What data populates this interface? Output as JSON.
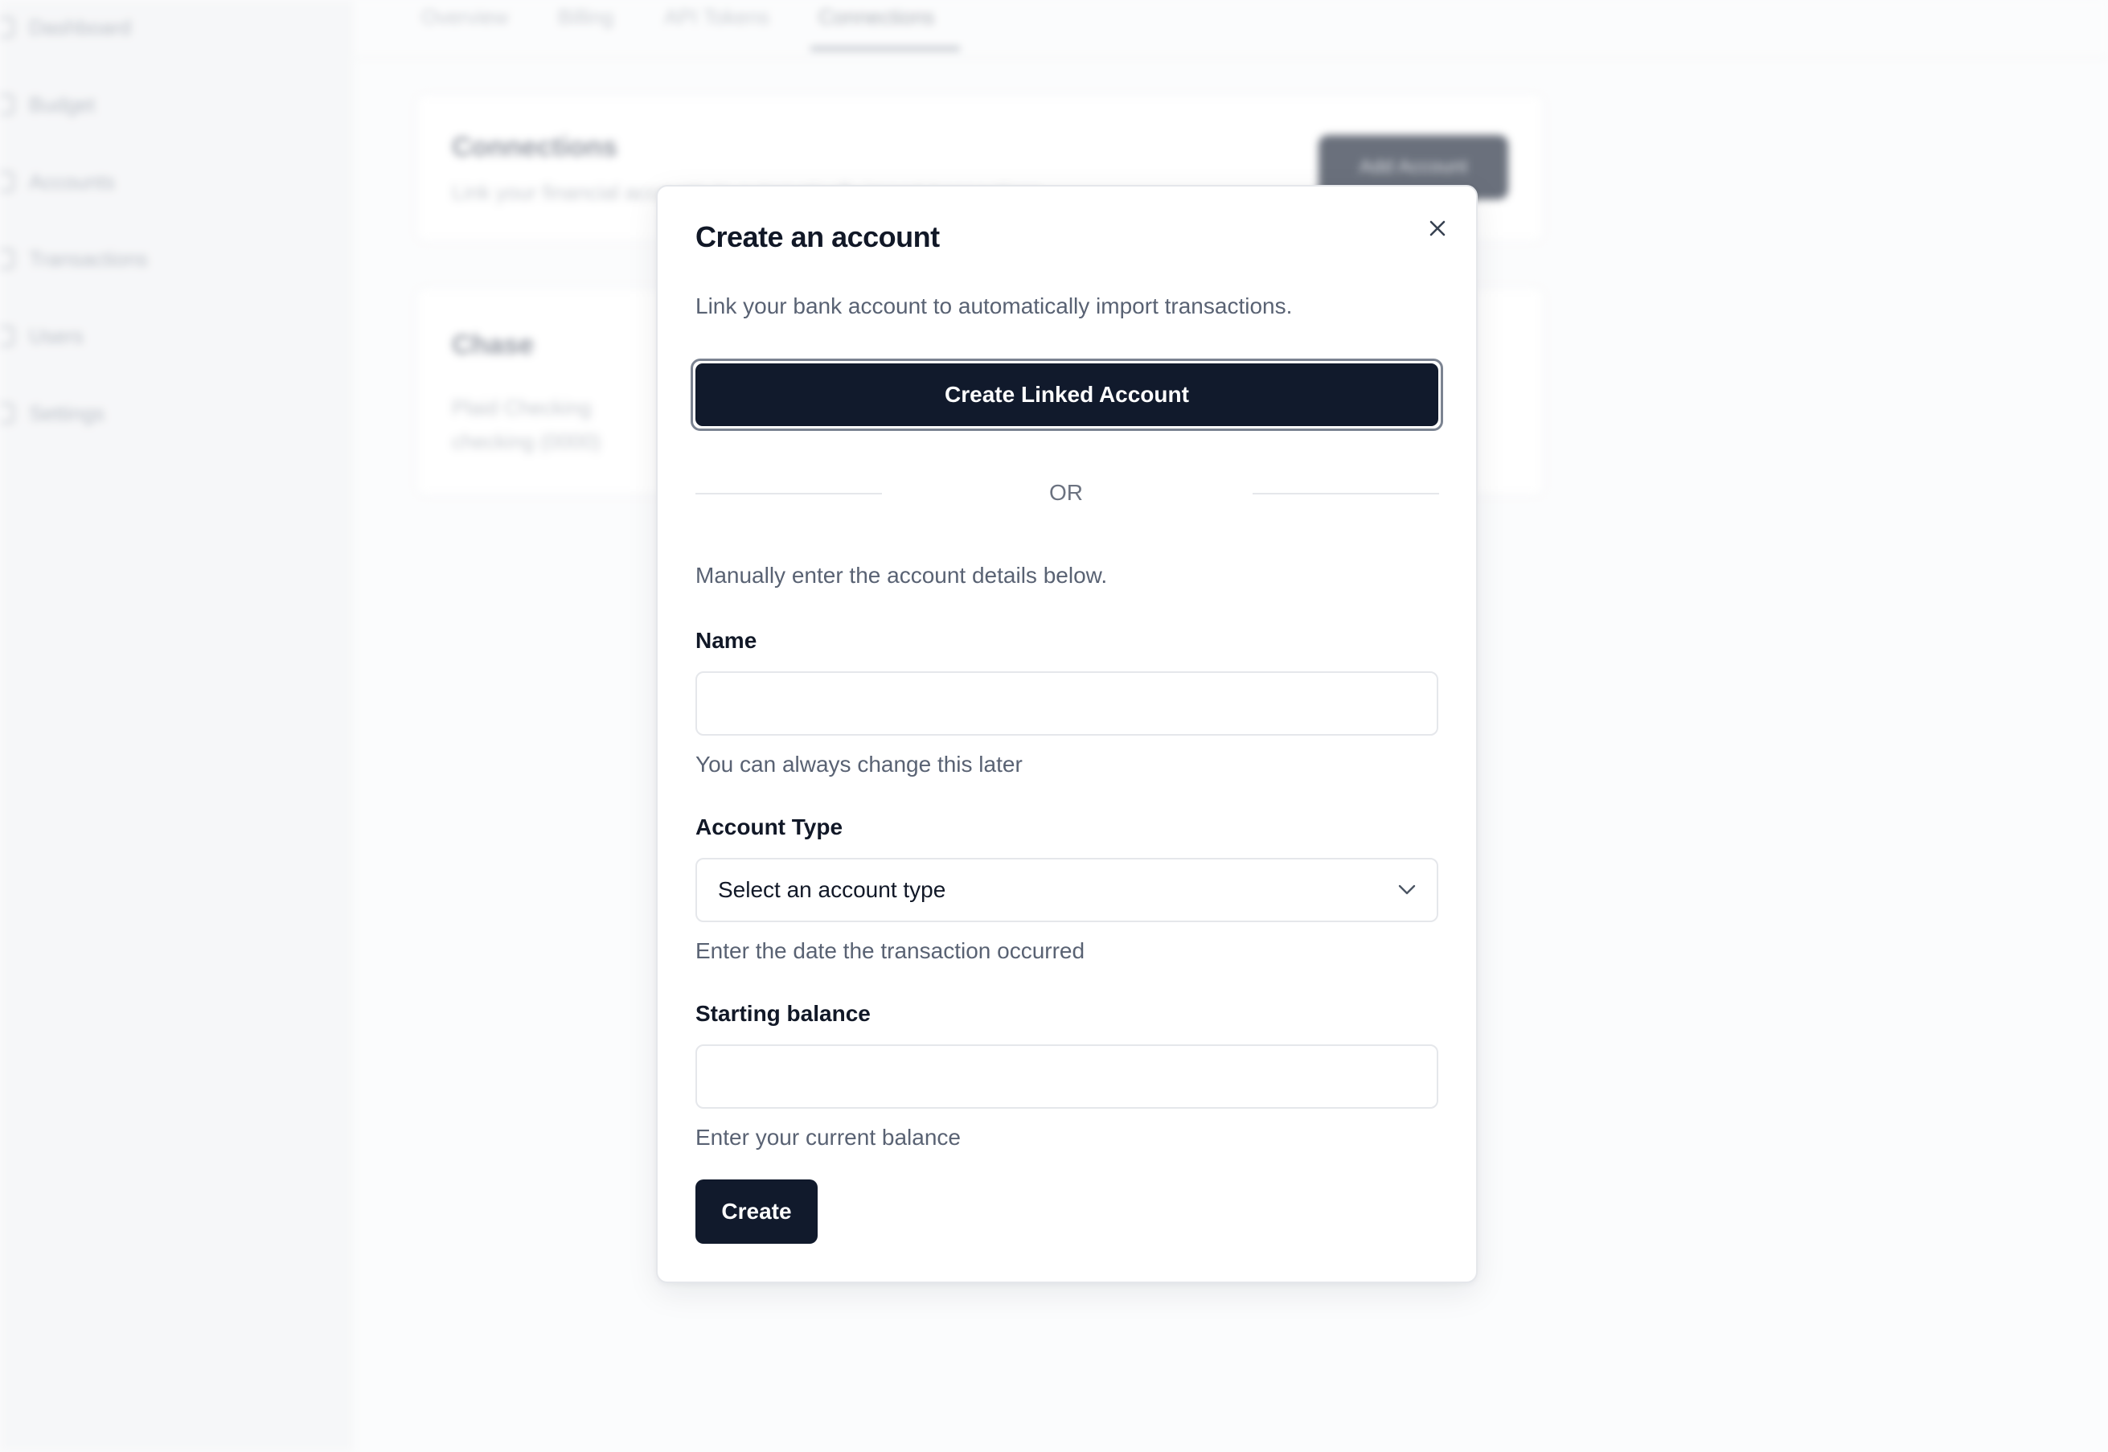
{
  "background": {
    "sidebar": {
      "items": [
        {
          "label": "Dashboard"
        },
        {
          "label": "Budget"
        },
        {
          "label": "Accounts"
        },
        {
          "label": "Transactions"
        },
        {
          "label": "Users"
        },
        {
          "label": "Settings"
        }
      ]
    },
    "tabs": [
      {
        "label": "Overview"
      },
      {
        "label": "Billing"
      },
      {
        "label": "API Tokens"
      },
      {
        "label": "Connections",
        "active": true
      }
    ],
    "connections_card": {
      "title": "Connections",
      "subtitle": "Link your financial accounts to automatically import transactions.",
      "add_button": "Add Account"
    },
    "chase_card": {
      "title": "Chase",
      "account_name": "Plaid Checking",
      "account_detail": "checking (0000)"
    }
  },
  "modal": {
    "title": "Create an account",
    "description": "Link your bank account to automatically import transactions.",
    "linked_button_label": "Create Linked Account",
    "divider_text": "OR",
    "manual_text": "Manually enter the account details below.",
    "name_field": {
      "label": "Name",
      "value": "",
      "hint": "You can always change this later"
    },
    "account_type_field": {
      "label": "Account Type",
      "selected": "Select an account type",
      "hint": "Enter the date the transaction occurred"
    },
    "starting_balance_field": {
      "label": "Starting balance",
      "value": "",
      "hint": "Enter your current balance"
    },
    "create_button_label": "Create"
  },
  "icons": {
    "close": "close-icon",
    "chevron": "chevron-down-icon"
  },
  "colors": {
    "primary_button": "#111a2c",
    "focus_ring": "#7b8391",
    "muted_text": "#596273",
    "border": "#e5e7eb"
  }
}
